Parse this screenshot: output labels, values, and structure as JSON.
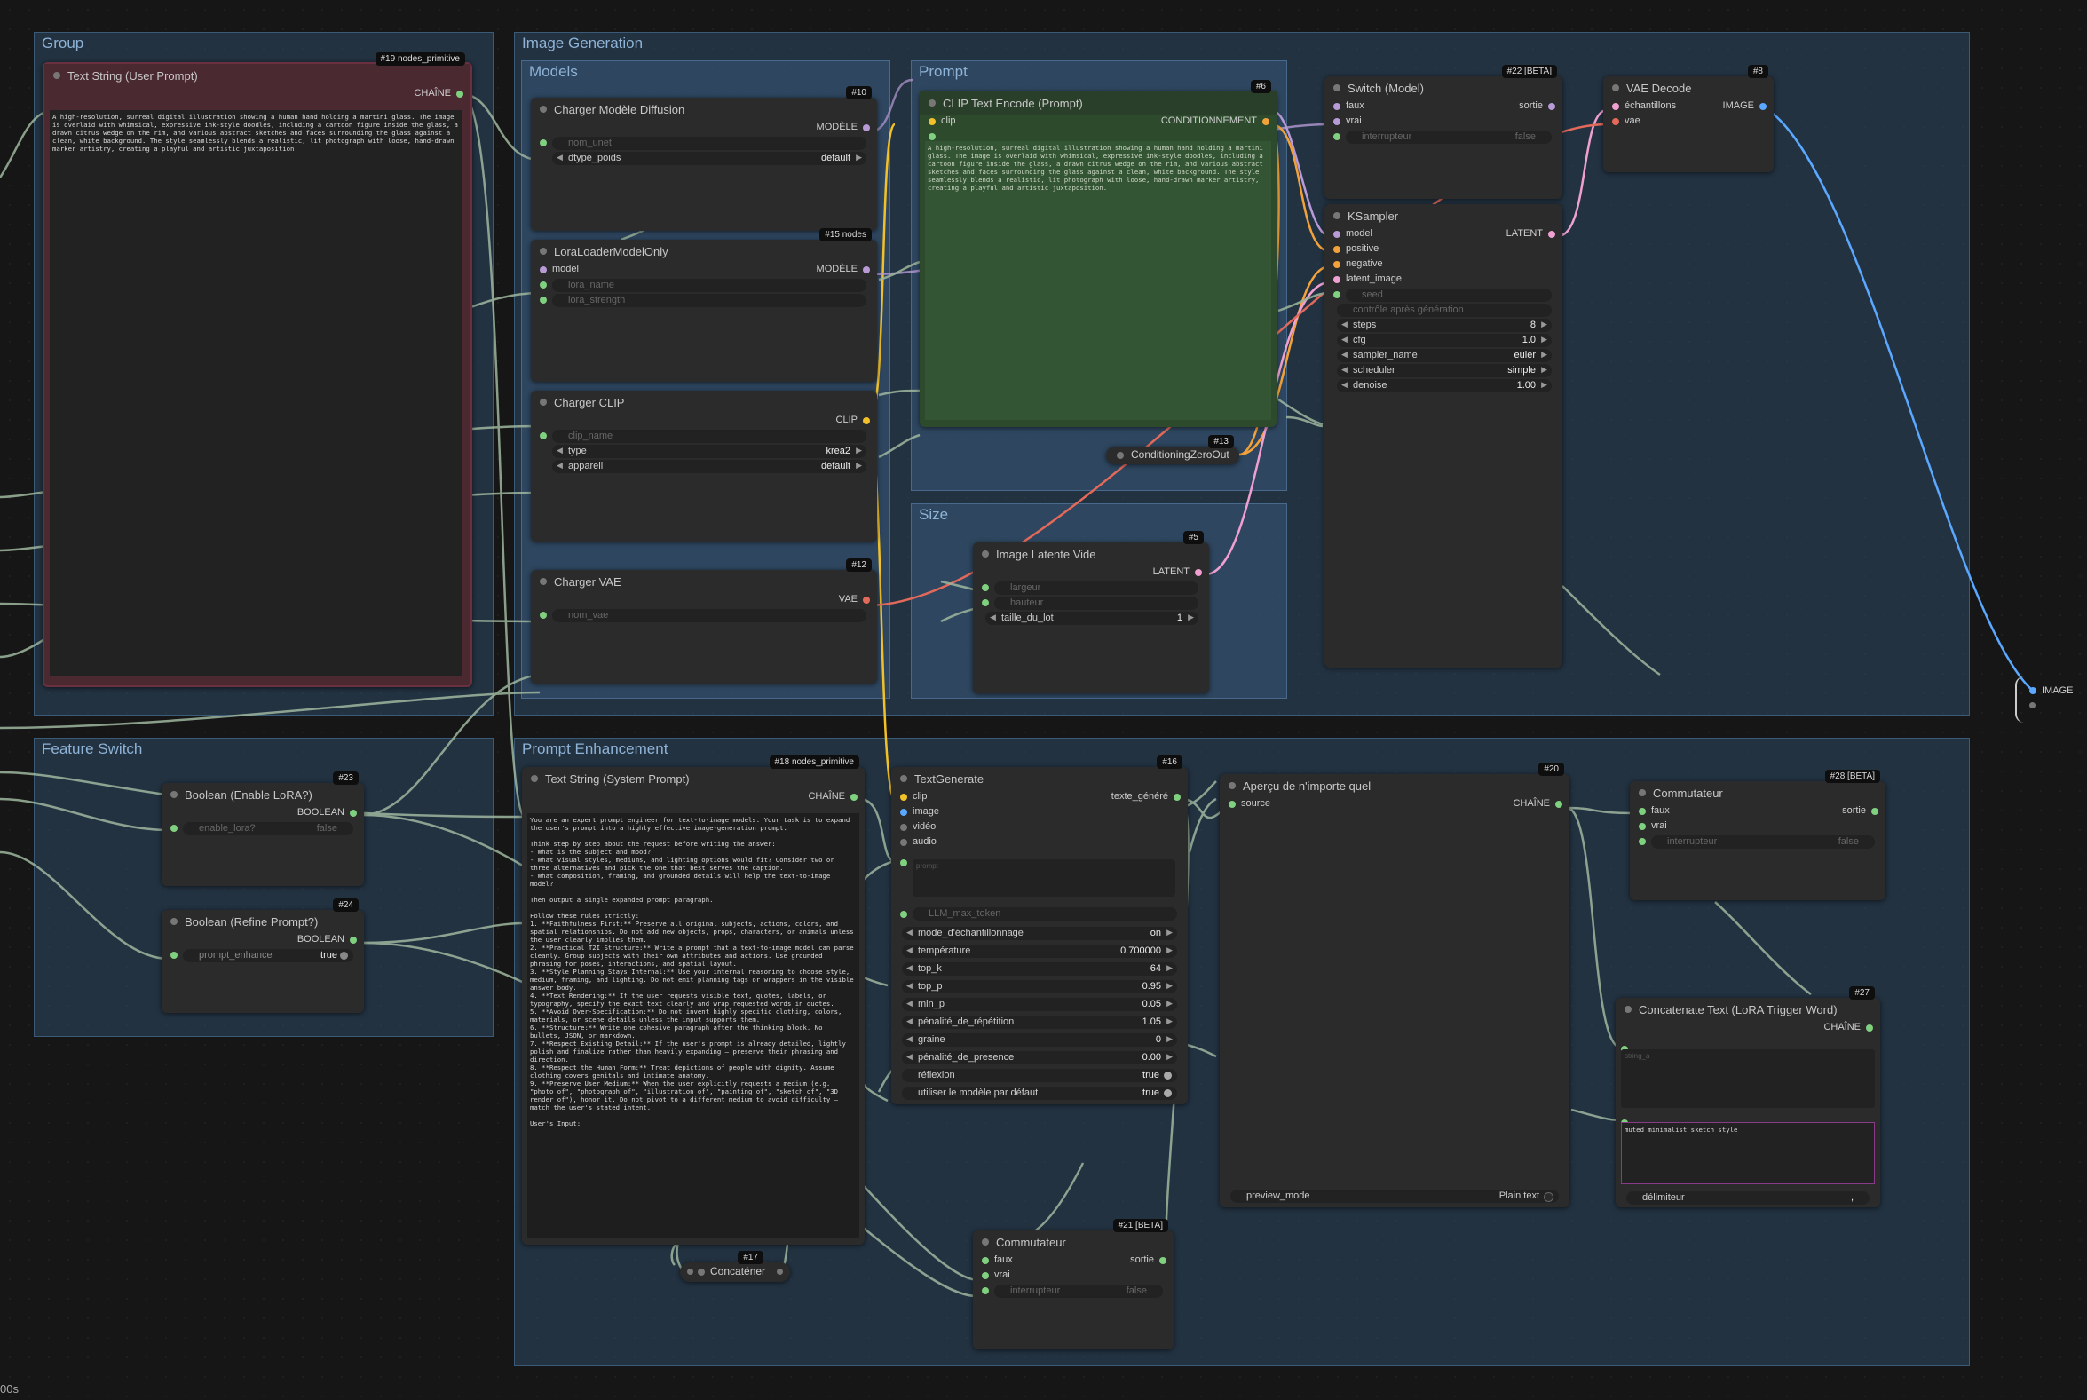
{
  "groups": {
    "group": "Group",
    "image_generation": "Image Generation",
    "models": "Models",
    "prompt": "Prompt",
    "size": "Size",
    "feature_switch": "Feature Switch",
    "prompt_enhancement": "Prompt Enhancement"
  },
  "nodes": {
    "text_user": {
      "badge": "#19 nodes_primitive",
      "title": "Text String (User Prompt)",
      "out": "CHAÎNE",
      "text": "A high-resolution, surreal digital illustration showing a human hand holding a martini glass. The image is overlaid with whimsical, expressive ink-style doodles, including a cartoon figure inside the glass, a drawn citrus wedge on the rim, and various abstract sketches and faces surrounding the glass against a clean, white background. The style seamlessly blends a realistic, lit photograph with loose, hand-drawn marker artistry, creating a playful and artistic juxtaposition."
    },
    "charger_diffusion": {
      "badge": "#10",
      "title": "Charger Modèle Diffusion",
      "out": "MODÈLE",
      "w1": "nom_unet",
      "w2_label": "dtype_poids",
      "w2_value": "default"
    },
    "lora_loader": {
      "badge": "#15 nodes",
      "title": "LoraLoaderModelOnly",
      "in1": "model",
      "out": "MODÈLE",
      "w1": "lora_name",
      "w2": "lora_strength"
    },
    "charger_clip": {
      "title": "Charger CLIP",
      "out": "CLIP",
      "w1": "clip_name",
      "w2_label": "type",
      "w2_value": "krea2",
      "w3_label": "appareil",
      "w3_value": "default"
    },
    "charger_vae": {
      "badge": "#12",
      "title": "Charger VAE",
      "out": "VAE",
      "w1": "nom_vae"
    },
    "clip_text": {
      "badge": "#6",
      "title": "CLIP Text Encode (Prompt)",
      "in1": "clip",
      "out": "CONDITIONNEMENT",
      "text": "A high-resolution, surreal digital illustration showing a human hand holding a martini glass. The image is overlaid with whimsical, expressive ink-style doodles, including a cartoon figure inside the glass, a drawn citrus wedge on the rim, and various abstract sketches and faces surrounding the glass against a clean, white background. The style seamlessly blends a realistic, lit photograph with loose, hand-drawn marker artistry, creating a playful and artistic juxtaposition."
    },
    "cond_zero": {
      "badge": "#13",
      "title": "ConditioningZeroOut"
    },
    "latent_image": {
      "badge": "#5",
      "title": "Image Latente Vide",
      "out": "LATENT",
      "w1": "largeur",
      "w2": "hauteur",
      "w3_label": "taille_du_lot",
      "w3_value": "1"
    },
    "switch_model": {
      "badge": "#22 [BETA]",
      "title": "Switch (Model)",
      "in1": "faux",
      "in2": "vrai",
      "out": "sortie",
      "w1_label": "interrupteur",
      "w1_value": "false"
    },
    "ksampler": {
      "title": "KSampler",
      "in1": "model",
      "in2": "positive",
      "in3": "negative",
      "in4": "latent_image",
      "out": "LATENT",
      "w_seed": "seed",
      "w_ctrl": "contrôle après génération",
      "steps_label": "steps",
      "steps": "8",
      "cfg_label": "cfg",
      "cfg": "1.0",
      "sampler_label": "sampler_name",
      "sampler": "euler",
      "scheduler_label": "scheduler",
      "scheduler": "simple",
      "denoise_label": "denoise",
      "denoise": "1.00"
    },
    "vae_decode": {
      "badge": "#8",
      "title": "VAE Decode",
      "in1": "échantillons",
      "in2": "vae",
      "out": "IMAGE"
    },
    "reroute_image": {
      "label": "IMAGE"
    },
    "bool_lora": {
      "badge": "#23",
      "title": "Boolean (Enable LoRA?)",
      "out": "BOOLEAN",
      "w_label": "enable_lora?",
      "w_value": "false"
    },
    "bool_refine": {
      "badge": "#24",
      "title": "Boolean (Refine Prompt?)",
      "out": "BOOLEAN",
      "w_label": "prompt_enhance",
      "w_value": "true"
    },
    "text_system": {
      "badge": "#18 nodes_primitive",
      "title": "Text String (System Prompt)",
      "out": "CHAÎNE",
      "text": "You are an expert prompt engineer for text-to-image models. Your task is to expand the user's prompt into a highly effective image-generation prompt.\n\nThink step by step about the request before writing the answer:\n- What is the subject and mood?\n- What visual styles, mediums, and lighting options would fit? Consider two or three alternatives and pick the one that best serves the caption.\n- What composition, framing, and grounded details will help the text-to-image model?\n\nThen output a single expanded prompt paragraph.\n\nFollow these rules strictly:\n1. **Faithfulness First:** Preserve all original subjects, actions, colors, and spatial relationships. Do not add new objects, props, characters, or animals unless the user clearly implies them.\n2. **Practical T2I Structure:** Write a prompt that a text-to-image model can parse cleanly. Group subjects with their own attributes and actions. Use grounded phrasing for poses, interactions, and spatial layout.\n3. **Style Planning Stays Internal:** Use your internal reasoning to choose style, medium, framing, and lighting. Do not emit planning tags or wrappers in the visible answer body.\n4. **Text Rendering:** If the user requests visible text, quotes, labels, or typography, specify the exact text clearly and wrap requested words in quotes.\n5. **Avoid Over-Specification:** Do not invent highly specific clothing, colors, materials, or scene details unless the input supports them.\n6. **Structure:** Write one cohesive paragraph after the thinking block. No bullets, JSON, or markdown.\n7. **Respect Existing Detail:** If the user's prompt is already detailed, lightly polish and finalize rather than heavily expanding — preserve their phrasing and direction.\n8. **Respect the Human Form:** Treat depictions of people with dignity. Assume clothing covers genitals and intimate anatomy.\n9. **Preserve User Medium:** When the user explicitly requests a medium (e.g. \"photo of\", \"photograph of\", \"illustration of\", \"painting of\", \"sketch of\", \"3D render of\"), honor it. Do not pivot to a different medium to avoid difficulty — match the user's stated intent.\n\nUser's Input:"
    },
    "concat17": {
      "badge": "#17",
      "title": "Concaténer"
    },
    "textgen": {
      "badge": "#16",
      "title": "TextGenerate",
      "in1": "clip",
      "in2": "image",
      "in3": "vidéo",
      "in4": "audio",
      "out": "texte_généré",
      "prompt_ph": "prompt",
      "w_max": "LLM_max_token",
      "rows": [
        [
          "mode_d'échantillonnage",
          "on"
        ],
        [
          "température",
          "0.700000"
        ],
        [
          "top_k",
          "64"
        ],
        [
          "top_p",
          "0.95"
        ],
        [
          "min_p",
          "0.05"
        ],
        [
          "pénalité_de_répétition",
          "1.05"
        ],
        [
          "graine",
          "0"
        ],
        [
          "pénalité_de_presence",
          "0.00"
        ]
      ],
      "t1_label": "réflexion",
      "t1_value": "true",
      "t2_label": "utiliser le modèle par défaut",
      "t2_value": "true"
    },
    "apercu": {
      "badge": "#20",
      "title": "Aperçu de n'importe quel",
      "in1": "source",
      "out": "CHAÎNE",
      "w_label": "preview_mode",
      "w_value": "Plain text"
    },
    "commut28": {
      "badge": "#28 [BETA]",
      "title": "Commutateur",
      "in1": "faux",
      "in2": "vrai",
      "out": "sortie",
      "w_label": "interrupteur",
      "w_value": "false"
    },
    "concat27": {
      "badge": "#27",
      "title": "Concatenate Text (LoRA Trigger Word)",
      "out": "CHAÎNE",
      "ph": "string_a",
      "text": "muted minimalist sketch style",
      "w_label": "délimiteur",
      "w_value": ","
    },
    "commut21": {
      "badge": "#21 [BETA]",
      "title": "Commutateur",
      "in1": "faux",
      "in2": "vrai",
      "out": "sortie",
      "w_label": "interrupteur",
      "w_value": "false"
    }
  },
  "footer": {
    "corner": "00s"
  },
  "colors": {
    "canvas": "#161616",
    "group": "#2e4a66",
    "prompt_node": "#2d4a2d",
    "text_node": "#4a2a30",
    "wire_clip": "#f2c12a",
    "wire_model": "#b79ad6",
    "wire_cond": "#f3a23a",
    "wire_image": "#5aa8ff",
    "wire_vae": "#e36a5a",
    "wire_default": "#9fb79f"
  }
}
